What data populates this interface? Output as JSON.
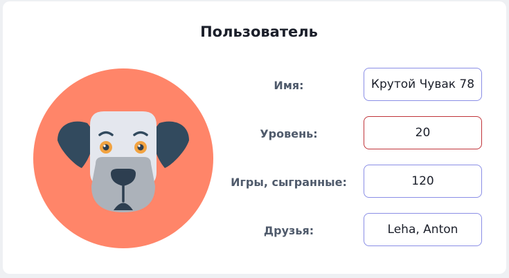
{
  "page": {
    "title": "Пользователь"
  },
  "avatar": {
    "icon": "dog-icon",
    "colors": {
      "background": "#ff8569",
      "ear": "#324a5e",
      "face": "#e4e7ee",
      "muzzle": "#acb2ba",
      "eye": "#f2a341",
      "nose": "#2d3e50"
    }
  },
  "fields": {
    "name": {
      "label": "Имя:",
      "value": "Крутой Чувак 78"
    },
    "level": {
      "label": "Уровень:",
      "value": "20",
      "state": "error"
    },
    "games": {
      "label": "Игры, сыгранные:",
      "value": "120"
    },
    "friends": {
      "label": "Друзья:",
      "value": "Leha, Anton"
    }
  },
  "colors": {
    "field_border": "#8a8ee6",
    "field_border_error": "#c0343a",
    "label_text": "#4f5a6b"
  }
}
